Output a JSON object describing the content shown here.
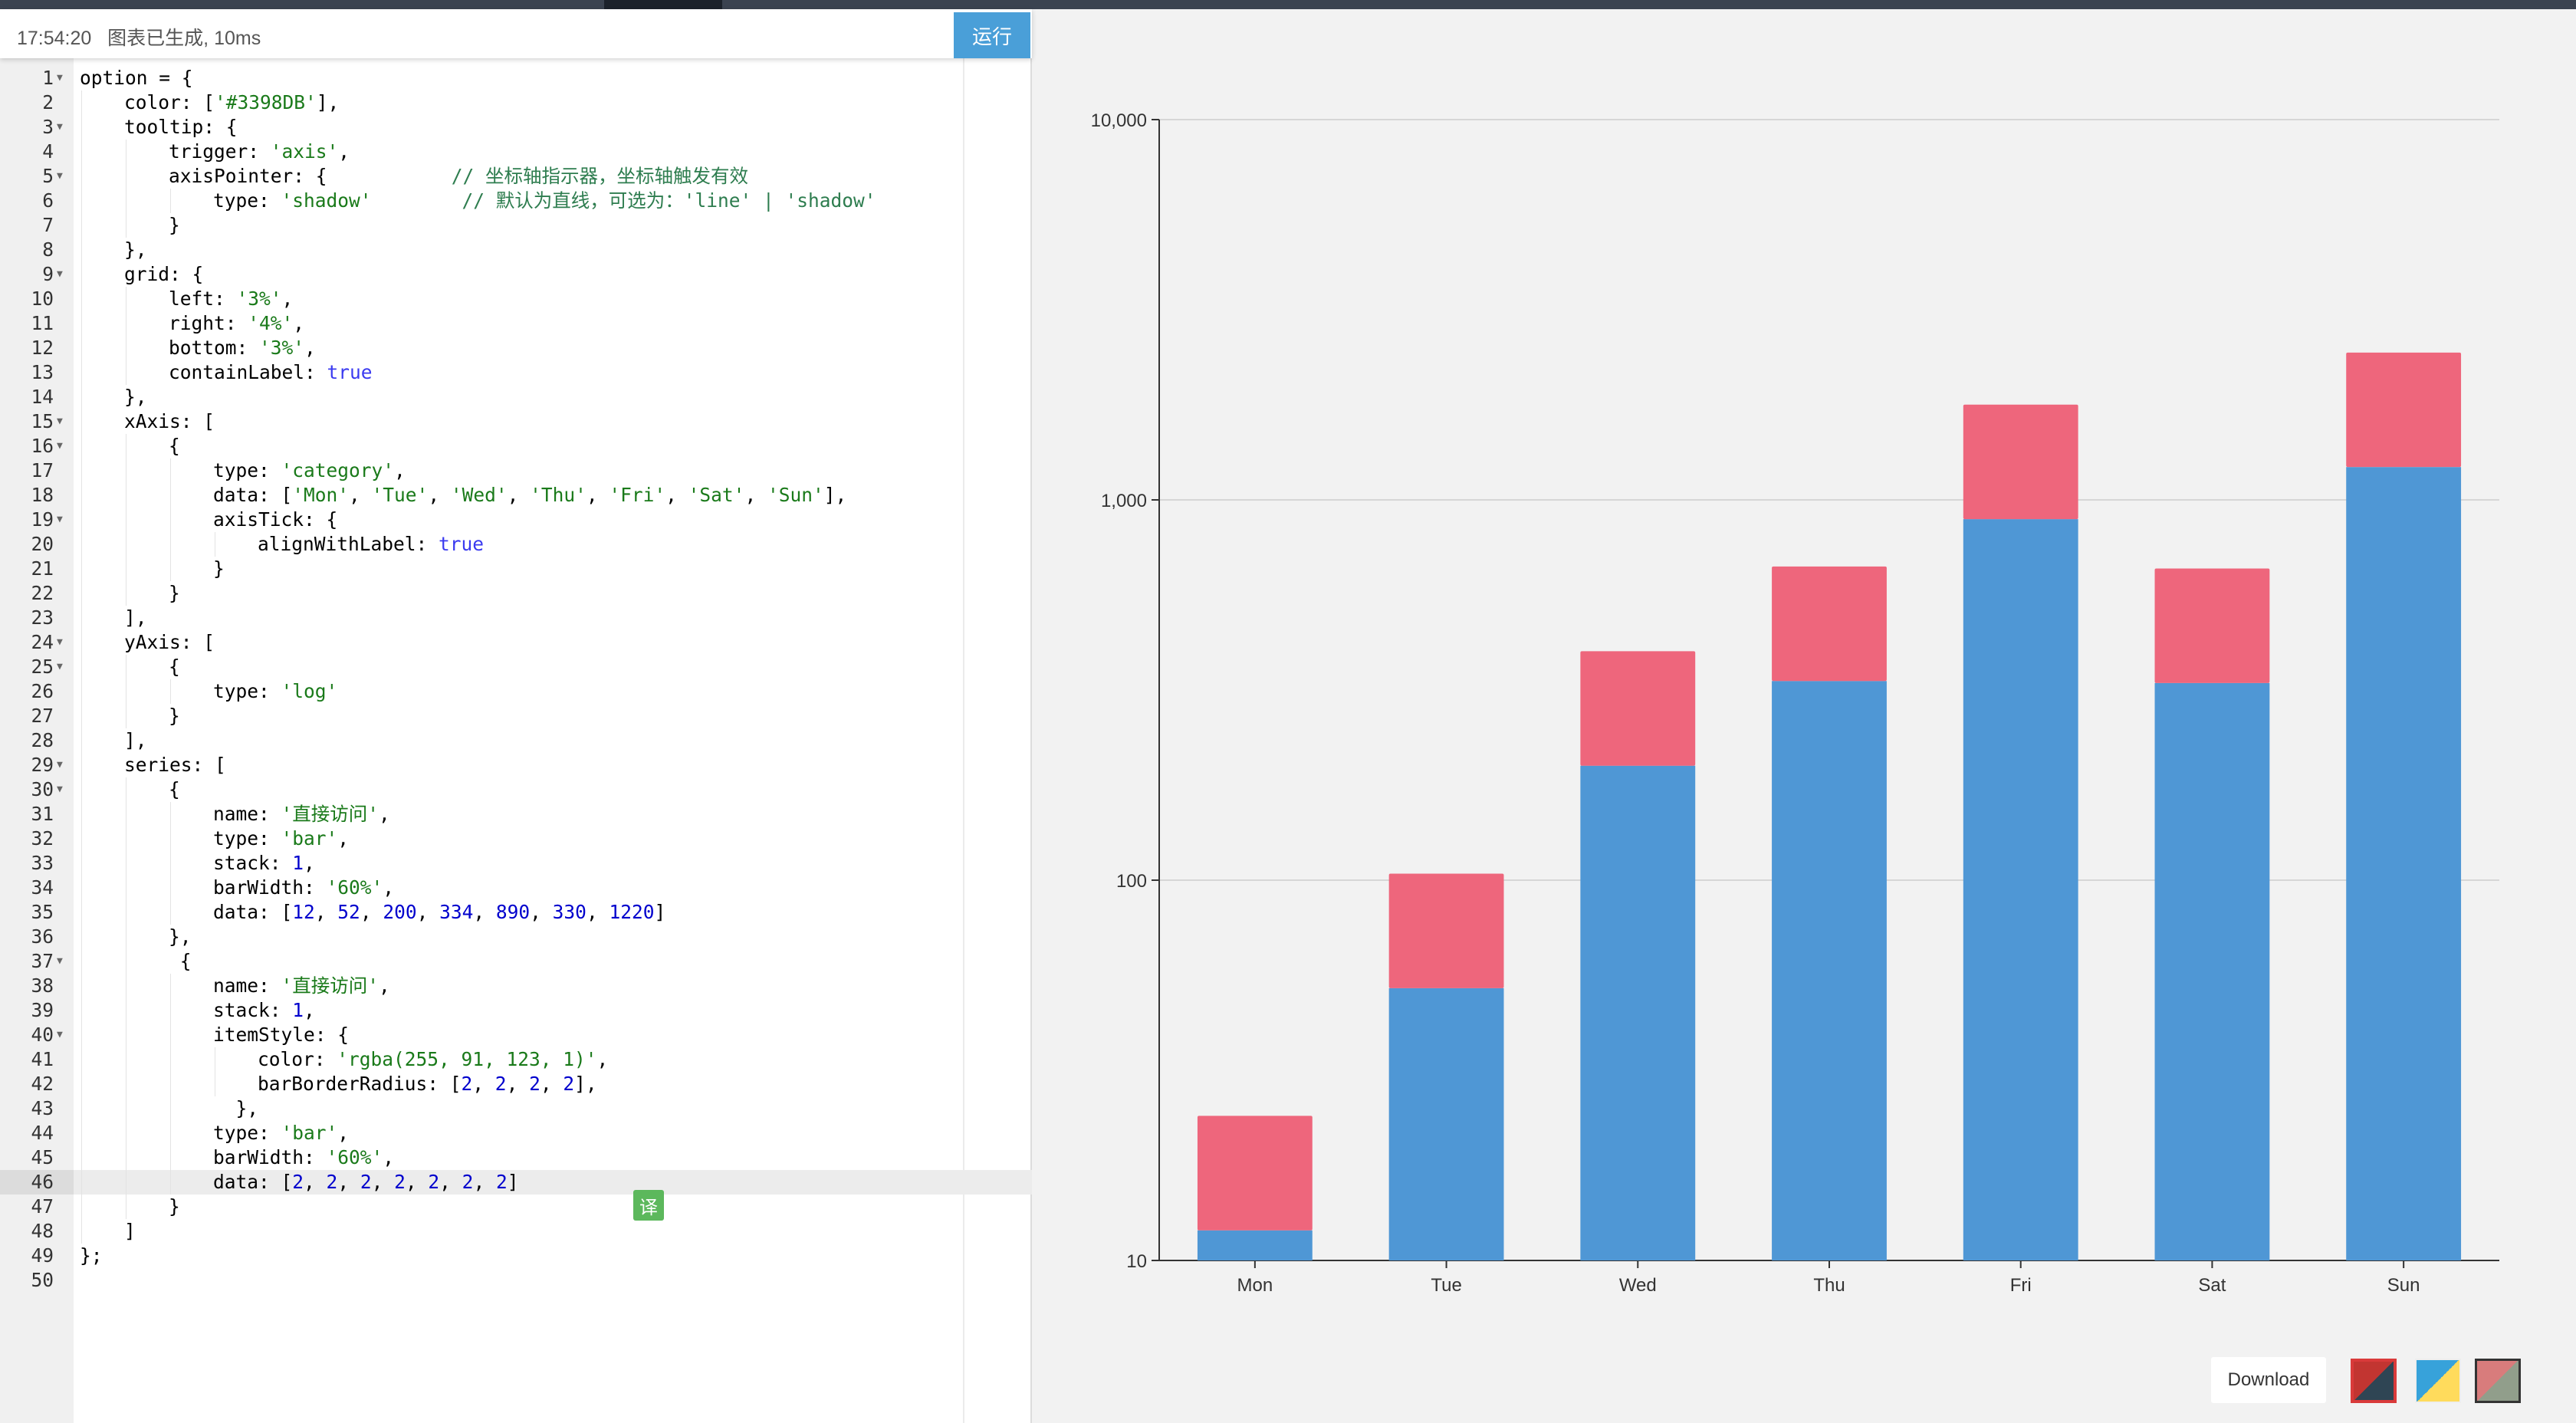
{
  "status": {
    "time": "17:54:20",
    "message": "图表已生成, 10ms"
  },
  "toolbar": {
    "run_label": "运行"
  },
  "editor": {
    "active_line": 46,
    "lines": [
      {
        "n": "1",
        "fold": true,
        "indent": 0,
        "tokens": [
          [
            "p",
            "option = {"
          ]
        ]
      },
      {
        "n": "2",
        "fold": false,
        "indent": 1,
        "tokens": [
          [
            "p",
            "color: ["
          ],
          [
            "s",
            "'#3398DB'"
          ],
          [
            "p",
            "],"
          ]
        ]
      },
      {
        "n": "3",
        "fold": true,
        "indent": 1,
        "tokens": [
          [
            "p",
            "tooltip: {"
          ]
        ]
      },
      {
        "n": "4",
        "fold": false,
        "indent": 2,
        "tokens": [
          [
            "p",
            "trigger: "
          ],
          [
            "s",
            "'axis'"
          ],
          [
            "p",
            ","
          ]
        ]
      },
      {
        "n": "5",
        "fold": true,
        "indent": 2,
        "tokens": [
          [
            "p",
            "axisPointer: {           "
          ],
          [
            "c",
            "// 坐标轴指示器，坐标轴触发有效"
          ]
        ]
      },
      {
        "n": "6",
        "fold": false,
        "indent": 3,
        "tokens": [
          [
            "p",
            "type: "
          ],
          [
            "s",
            "'shadow'"
          ],
          [
            "p",
            "        "
          ],
          [
            "c",
            "// 默认为直线，可选为：'line' | 'shadow'"
          ]
        ]
      },
      {
        "n": "7",
        "fold": false,
        "indent": 2,
        "tokens": [
          [
            "p",
            "}"
          ]
        ]
      },
      {
        "n": "8",
        "fold": false,
        "indent": 1,
        "tokens": [
          [
            "p",
            "},"
          ]
        ]
      },
      {
        "n": "9",
        "fold": true,
        "indent": 1,
        "tokens": [
          [
            "p",
            "grid: {"
          ]
        ]
      },
      {
        "n": "10",
        "fold": false,
        "indent": 2,
        "tokens": [
          [
            "p",
            "left: "
          ],
          [
            "s",
            "'3%'"
          ],
          [
            "p",
            ","
          ]
        ]
      },
      {
        "n": "11",
        "fold": false,
        "indent": 2,
        "tokens": [
          [
            "p",
            "right: "
          ],
          [
            "s",
            "'4%'"
          ],
          [
            "p",
            ","
          ]
        ]
      },
      {
        "n": "12",
        "fold": false,
        "indent": 2,
        "tokens": [
          [
            "p",
            "bottom: "
          ],
          [
            "s",
            "'3%'"
          ],
          [
            "p",
            ","
          ]
        ]
      },
      {
        "n": "13",
        "fold": false,
        "indent": 2,
        "tokens": [
          [
            "p",
            "containLabel: "
          ],
          [
            "k",
            "true"
          ]
        ]
      },
      {
        "n": "14",
        "fold": false,
        "indent": 1,
        "tokens": [
          [
            "p",
            "},"
          ]
        ]
      },
      {
        "n": "15",
        "fold": true,
        "indent": 1,
        "tokens": [
          [
            "p",
            "xAxis: ["
          ]
        ]
      },
      {
        "n": "16",
        "fold": true,
        "indent": 2,
        "tokens": [
          [
            "p",
            "{"
          ]
        ]
      },
      {
        "n": "17",
        "fold": false,
        "indent": 3,
        "tokens": [
          [
            "p",
            "type: "
          ],
          [
            "s",
            "'category'"
          ],
          [
            "p",
            ","
          ]
        ]
      },
      {
        "n": "18",
        "fold": false,
        "indent": 3,
        "tokens": [
          [
            "p",
            "data: ["
          ],
          [
            "s",
            "'Mon'"
          ],
          [
            "p",
            ", "
          ],
          [
            "s",
            "'Tue'"
          ],
          [
            "p",
            ", "
          ],
          [
            "s",
            "'Wed'"
          ],
          [
            "p",
            ", "
          ],
          [
            "s",
            "'Thu'"
          ],
          [
            "p",
            ", "
          ],
          [
            "s",
            "'Fri'"
          ],
          [
            "p",
            ", "
          ],
          [
            "s",
            "'Sat'"
          ],
          [
            "p",
            ", "
          ],
          [
            "s",
            "'Sun'"
          ],
          [
            "p",
            "],"
          ]
        ]
      },
      {
        "n": "19",
        "fold": true,
        "indent": 3,
        "tokens": [
          [
            "p",
            "axisTick: {"
          ]
        ]
      },
      {
        "n": "20",
        "fold": false,
        "indent": 4,
        "tokens": [
          [
            "p",
            "alignWithLabel: "
          ],
          [
            "k",
            "true"
          ]
        ]
      },
      {
        "n": "21",
        "fold": false,
        "indent": 3,
        "tokens": [
          [
            "p",
            "}"
          ]
        ]
      },
      {
        "n": "22",
        "fold": false,
        "indent": 2,
        "tokens": [
          [
            "p",
            "}"
          ]
        ]
      },
      {
        "n": "23",
        "fold": false,
        "indent": 1,
        "tokens": [
          [
            "p",
            "],"
          ]
        ]
      },
      {
        "n": "24",
        "fold": true,
        "indent": 1,
        "tokens": [
          [
            "p",
            "yAxis: ["
          ]
        ]
      },
      {
        "n": "25",
        "fold": true,
        "indent": 2,
        "tokens": [
          [
            "p",
            "{"
          ]
        ]
      },
      {
        "n": "26",
        "fold": false,
        "indent": 3,
        "tokens": [
          [
            "p",
            "type: "
          ],
          [
            "s",
            "'log'"
          ]
        ]
      },
      {
        "n": "27",
        "fold": false,
        "indent": 2,
        "tokens": [
          [
            "p",
            "}"
          ]
        ]
      },
      {
        "n": "28",
        "fold": false,
        "indent": 1,
        "tokens": [
          [
            "p",
            "],"
          ]
        ]
      },
      {
        "n": "29",
        "fold": true,
        "indent": 1,
        "tokens": [
          [
            "p",
            "series: ["
          ]
        ]
      },
      {
        "n": "30",
        "fold": true,
        "indent": 2,
        "tokens": [
          [
            "p",
            "{"
          ]
        ]
      },
      {
        "n": "31",
        "fold": false,
        "indent": 3,
        "tokens": [
          [
            "p",
            "name: "
          ],
          [
            "s",
            "'直接访问'"
          ],
          [
            "p",
            ","
          ]
        ]
      },
      {
        "n": "32",
        "fold": false,
        "indent": 3,
        "tokens": [
          [
            "p",
            "type: "
          ],
          [
            "s",
            "'bar'"
          ],
          [
            "p",
            ","
          ]
        ]
      },
      {
        "n": "33",
        "fold": false,
        "indent": 3,
        "tokens": [
          [
            "p",
            "stack: "
          ],
          [
            "n",
            "1"
          ],
          [
            "p",
            ","
          ]
        ]
      },
      {
        "n": "34",
        "fold": false,
        "indent": 3,
        "tokens": [
          [
            "p",
            "barWidth: "
          ],
          [
            "s",
            "'60%'"
          ],
          [
            "p",
            ","
          ]
        ]
      },
      {
        "n": "35",
        "fold": false,
        "indent": 3,
        "tokens": [
          [
            "p",
            "data: ["
          ],
          [
            "n",
            "12"
          ],
          [
            "p",
            ", "
          ],
          [
            "n",
            "52"
          ],
          [
            "p",
            ", "
          ],
          [
            "n",
            "200"
          ],
          [
            "p",
            ", "
          ],
          [
            "n",
            "334"
          ],
          [
            "p",
            ", "
          ],
          [
            "n",
            "890"
          ],
          [
            "p",
            ", "
          ],
          [
            "n",
            "330"
          ],
          [
            "p",
            ", "
          ],
          [
            "n",
            "1220"
          ],
          [
            "p",
            "]"
          ]
        ]
      },
      {
        "n": "36",
        "fold": false,
        "indent": 2,
        "tokens": [
          [
            "p",
            "},"
          ]
        ]
      },
      {
        "n": "37",
        "fold": true,
        "indent": 2,
        "tokens": [
          [
            "p",
            " {"
          ]
        ]
      },
      {
        "n": "38",
        "fold": false,
        "indent": 3,
        "tokens": [
          [
            "p",
            "name: "
          ],
          [
            "s",
            "'直接访问'"
          ],
          [
            "p",
            ","
          ]
        ]
      },
      {
        "n": "39",
        "fold": false,
        "indent": 3,
        "tokens": [
          [
            "p",
            "stack: "
          ],
          [
            "n",
            "1"
          ],
          [
            "p",
            ","
          ]
        ]
      },
      {
        "n": "40",
        "fold": true,
        "indent": 3,
        "tokens": [
          [
            "p",
            "itemStyle: {"
          ]
        ]
      },
      {
        "n": "41",
        "fold": false,
        "indent": 4,
        "tokens": [
          [
            "p",
            "color: "
          ],
          [
            "s",
            "'rgba(255, 91, 123, 1)'"
          ],
          [
            "p",
            ","
          ]
        ]
      },
      {
        "n": "42",
        "fold": false,
        "indent": 4,
        "tokens": [
          [
            "p",
            "barBorderRadius: ["
          ],
          [
            "n",
            "2"
          ],
          [
            "p",
            ", "
          ],
          [
            "n",
            "2"
          ],
          [
            "p",
            ", "
          ],
          [
            "n",
            "2"
          ],
          [
            "p",
            ", "
          ],
          [
            "n",
            "2"
          ],
          [
            "p",
            "],"
          ]
        ]
      },
      {
        "n": "43",
        "fold": false,
        "indent": 3,
        "tokens": [
          [
            "p",
            "  },"
          ]
        ]
      },
      {
        "n": "44",
        "fold": false,
        "indent": 3,
        "tokens": [
          [
            "p",
            "type: "
          ],
          [
            "s",
            "'bar'"
          ],
          [
            "p",
            ","
          ]
        ]
      },
      {
        "n": "45",
        "fold": false,
        "indent": 3,
        "tokens": [
          [
            "p",
            "barWidth: "
          ],
          [
            "s",
            "'60%'"
          ],
          [
            "p",
            ","
          ]
        ]
      },
      {
        "n": "46",
        "fold": false,
        "indent": 3,
        "tokens": [
          [
            "p",
            "data: ["
          ],
          [
            "n",
            "2"
          ],
          [
            "p",
            ", "
          ],
          [
            "n",
            "2"
          ],
          [
            "p",
            ", "
          ],
          [
            "n",
            "2"
          ],
          [
            "p",
            ", "
          ],
          [
            "n",
            "2"
          ],
          [
            "p",
            ", "
          ],
          [
            "n",
            "2"
          ],
          [
            "p",
            ", "
          ],
          [
            "n",
            "2"
          ],
          [
            "p",
            ", "
          ],
          [
            "n",
            "2"
          ],
          [
            "p",
            "]"
          ]
        ]
      },
      {
        "n": "47",
        "fold": false,
        "indent": 2,
        "tokens": [
          [
            "p",
            "}"
          ]
        ]
      },
      {
        "n": "48",
        "fold": false,
        "indent": 1,
        "tokens": [
          [
            "p",
            "]"
          ]
        ]
      },
      {
        "n": "49",
        "fold": false,
        "indent": 0,
        "tokens": [
          [
            "p",
            "};"
          ]
        ]
      },
      {
        "n": "50",
        "fold": false,
        "indent": 0,
        "tokens": []
      }
    ]
  },
  "translate_badge": "译",
  "chart_data": {
    "type": "bar",
    "stacked": true,
    "yscale": "log",
    "ylim": [
      10,
      10000
    ],
    "yticks": [
      10,
      100,
      1000,
      10000
    ],
    "ytick_labels": [
      "10",
      "100",
      "1,000",
      "10,000"
    ],
    "categories": [
      "Mon",
      "Tue",
      "Wed",
      "Thu",
      "Fri",
      "Sat",
      "Sun"
    ],
    "series": [
      {
        "values": [
          12,
          52,
          200,
          334,
          890,
          330,
          1220
        ],
        "color": "#4f97d5"
      },
      {
        "values": [
          12,
          52,
          200,
          334,
          890,
          330,
          1220
        ],
        "color": "#ee667c"
      }
    ]
  },
  "footer": {
    "download_label": "Download"
  }
}
